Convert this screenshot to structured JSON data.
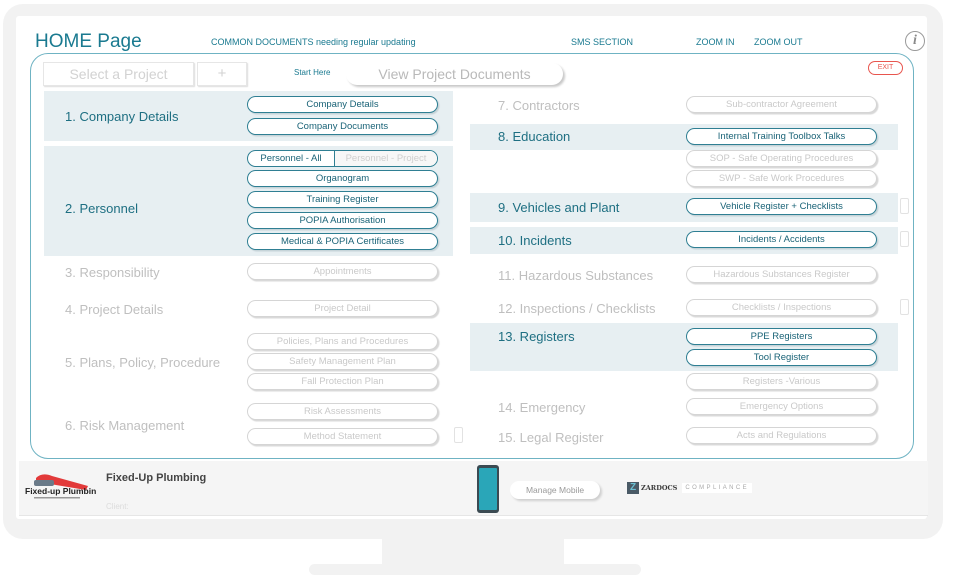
{
  "header": {
    "title": "HOME Page",
    "links": [
      {
        "label": "COMMON DOCUMENTS needing regular updating"
      },
      {
        "label": "SMS SECTION"
      },
      {
        "label": "ZOOM IN"
      },
      {
        "label": "ZOOM OUT"
      }
    ],
    "info_icon": "info-icon"
  },
  "toolbar": {
    "select_project_placeholder": "Select a Project",
    "plus_label": "+",
    "start_here": "Start Here",
    "view_docs": "View Project Documents",
    "exit": "EXIT"
  },
  "colors": {
    "accent": "#1a7a90",
    "active_band": "#e7eff2",
    "inactive_text": "#bfbfbf",
    "exit_red": "#e8554e"
  },
  "sections_left": [
    {
      "label": "1. Company Details",
      "active": true,
      "buttons": [
        "Company Details",
        "Company Documents"
      ]
    },
    {
      "label": "2. Personnel",
      "active": true,
      "split": {
        "left": "Personnel - All",
        "right": "Personnel - Project"
      },
      "buttons": [
        "Organogram",
        "Training Register",
        "POPIA Authorisation",
        "Medical & POPIA Certificates"
      ]
    },
    {
      "label": "3. Responsibility",
      "active": false,
      "buttons": [
        "Appointments"
      ]
    },
    {
      "label": "4. Project Details",
      "active": false,
      "buttons": [
        "Project Detail"
      ]
    },
    {
      "label": "5. Plans, Policy, Procedure",
      "active": false,
      "buttons": [
        "Policies, Plans and Procedures",
        "Safety Management Plan",
        "Fall Protection Plan"
      ]
    },
    {
      "label": "6. Risk Management",
      "active": false,
      "buttons": [
        "Risk Assessments",
        "Method Statement"
      ]
    }
  ],
  "sections_right": [
    {
      "label": "7. Contractors",
      "active": false,
      "buttons": [
        "Sub-contractor Agreement"
      ]
    },
    {
      "label": "8. Education",
      "active": true,
      "buttons": [
        "Internal Training Toolbox Talks",
        "SOP - Safe Operating Procedures",
        "SWP - Safe Work Procedures"
      ]
    },
    {
      "label": "9. Vehicles and Plant",
      "active": true,
      "buttons": [
        "Vehicle Register + Checklists"
      ]
    },
    {
      "label": "10. Incidents",
      "active": true,
      "buttons": [
        "Incidents / Accidents"
      ]
    },
    {
      "label": "11. Hazardous Substances",
      "active": false,
      "buttons": [
        "Hazardous Substances Register"
      ]
    },
    {
      "label": "12. Inspections / Checklists",
      "active": false,
      "buttons": [
        "Checklists / Inspections"
      ]
    },
    {
      "label": "13. Registers",
      "active": true,
      "buttons": [
        "PPE Registers",
        "Tool Register",
        "Registers  -Various"
      ]
    },
    {
      "label": "14. Emergency",
      "active": false,
      "buttons": [
        "Emergency Options"
      ]
    },
    {
      "label": "15. Legal Register",
      "active": false,
      "buttons": [
        "Acts and Regulations"
      ]
    }
  ],
  "footer": {
    "company_name": "Fixed-Up Plumbing",
    "logo_text": "Fixed-up Plumbing",
    "client_label": "Client:",
    "manage_mobile": "Manage Mobile",
    "brand_name": "ZARDOCS",
    "brand_tag": "COMPLIANCE"
  }
}
